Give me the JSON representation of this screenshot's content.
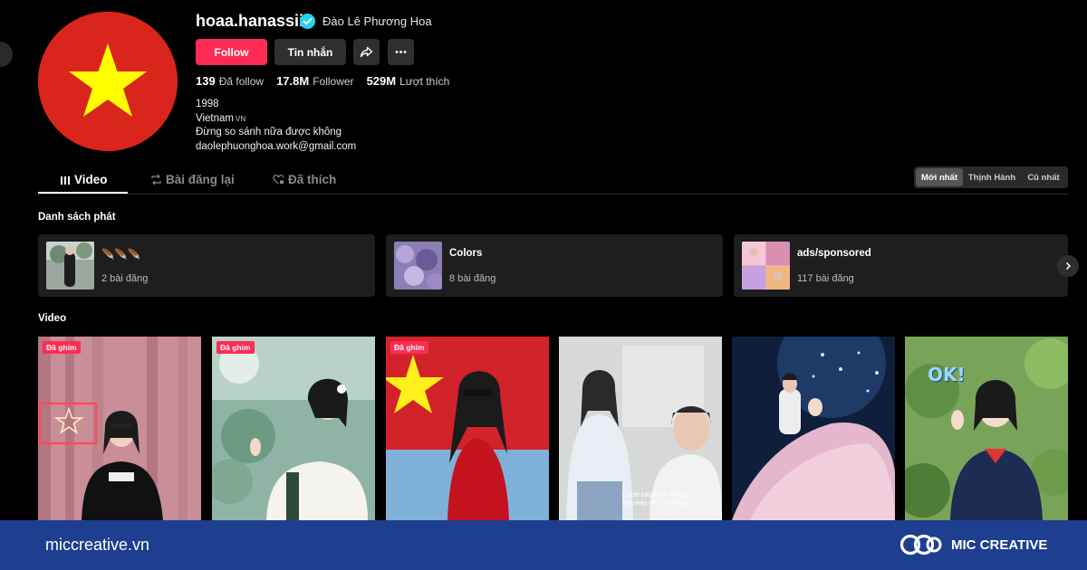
{
  "profile": {
    "username": "hoaa.hanassii",
    "display_name": "Đào Lê Phương Hoa",
    "follow_label": "Follow",
    "message_label": "Tin nhắn",
    "stats": [
      {
        "value": "139",
        "label": "Đã follow"
      },
      {
        "value": "17.8M",
        "label": "Follower"
      },
      {
        "value": "529M",
        "label": "Lượt thích"
      }
    ],
    "bio": {
      "line1": "1998",
      "country": "Vietnam",
      "country_code": "VN",
      "line3": "Đừng so sánh nữa được không",
      "email": "daolephuonghoa.work@gmail.com"
    }
  },
  "tabs": [
    {
      "label": "Video",
      "icon": "grid-bars-icon",
      "active": true
    },
    {
      "label": "Bài đăng lại",
      "icon": "repost-icon",
      "active": false
    },
    {
      "label": "Đã thích",
      "icon": "heart-lock-icon",
      "active": false
    }
  ],
  "sort": {
    "options": [
      "Mới nhất",
      "Thịnh Hành",
      "Cũ nhất"
    ],
    "active": "Mới nhất"
  },
  "playlists": {
    "title": "Danh sách phát",
    "items": [
      {
        "title": "🪶🪶🪶",
        "count": "2 bài đăng"
      },
      {
        "title": "Colors",
        "count": "8 bài đăng"
      },
      {
        "title": "ads/sponsored",
        "count": "117 bài đăng"
      }
    ]
  },
  "videos": {
    "title": "Video",
    "pinned_label": "Đã ghim",
    "caption_line1": "Crush bảo thích những",
    "caption_line2": "nhà máy chỉ cơ trường",
    "ok_text": "OK!"
  },
  "footer": {
    "site": "miccreative.vn",
    "brand": "MIC CREATIVE"
  },
  "colors": {
    "accent": "#fe2c55",
    "verified": "#20d5ec",
    "flag_red": "#da251d",
    "flag_star": "#ffff00",
    "footer_bg": "#1e3f8f"
  }
}
